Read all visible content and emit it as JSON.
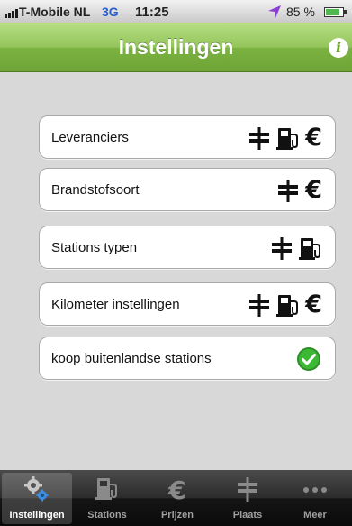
{
  "status_bar": {
    "carrier": "T-Mobile NL",
    "network": "3G",
    "time": "11:25",
    "battery_percent": "85 %",
    "battery_level": 0.85
  },
  "nav": {
    "title": "Instellingen",
    "info_icon": "info-icon"
  },
  "settings": {
    "rows": [
      {
        "label": "Leveranciers",
        "icons": [
          "signpost-icon",
          "fuel-pump-icon",
          "euro-icon"
        ]
      },
      {
        "label": "Brandstofsoort",
        "icons": [
          "signpost-icon",
          "euro-icon"
        ]
      },
      {
        "label": "Stations typen",
        "icons": [
          "signpost-icon",
          "fuel-pump-icon"
        ]
      },
      {
        "label": "Kilometer instellingen",
        "icons": [
          "signpost-icon",
          "fuel-pump-icon",
          "euro-icon"
        ]
      },
      {
        "label": "koop buitenlandse stations",
        "checked": true,
        "icons": [
          "check-icon"
        ]
      }
    ]
  },
  "tabbar": {
    "tabs": [
      {
        "label": "Instellingen",
        "icon": "gears-icon",
        "selected": true
      },
      {
        "label": "Stations",
        "icon": "fuel-pump-icon",
        "selected": false
      },
      {
        "label": "Prijzen",
        "icon": "euro-icon",
        "selected": false
      },
      {
        "label": "Plaats",
        "icon": "signpost-icon",
        "selected": false
      },
      {
        "label": "Meer",
        "icon": "more-icon",
        "selected": false
      }
    ]
  },
  "colors": {
    "nav_green": "#7bb342",
    "check_green": "#3cb934",
    "network_blue": "#2a5ec8",
    "location_purple": "#8a3fd1"
  },
  "symbols": {
    "euro": "€"
  }
}
